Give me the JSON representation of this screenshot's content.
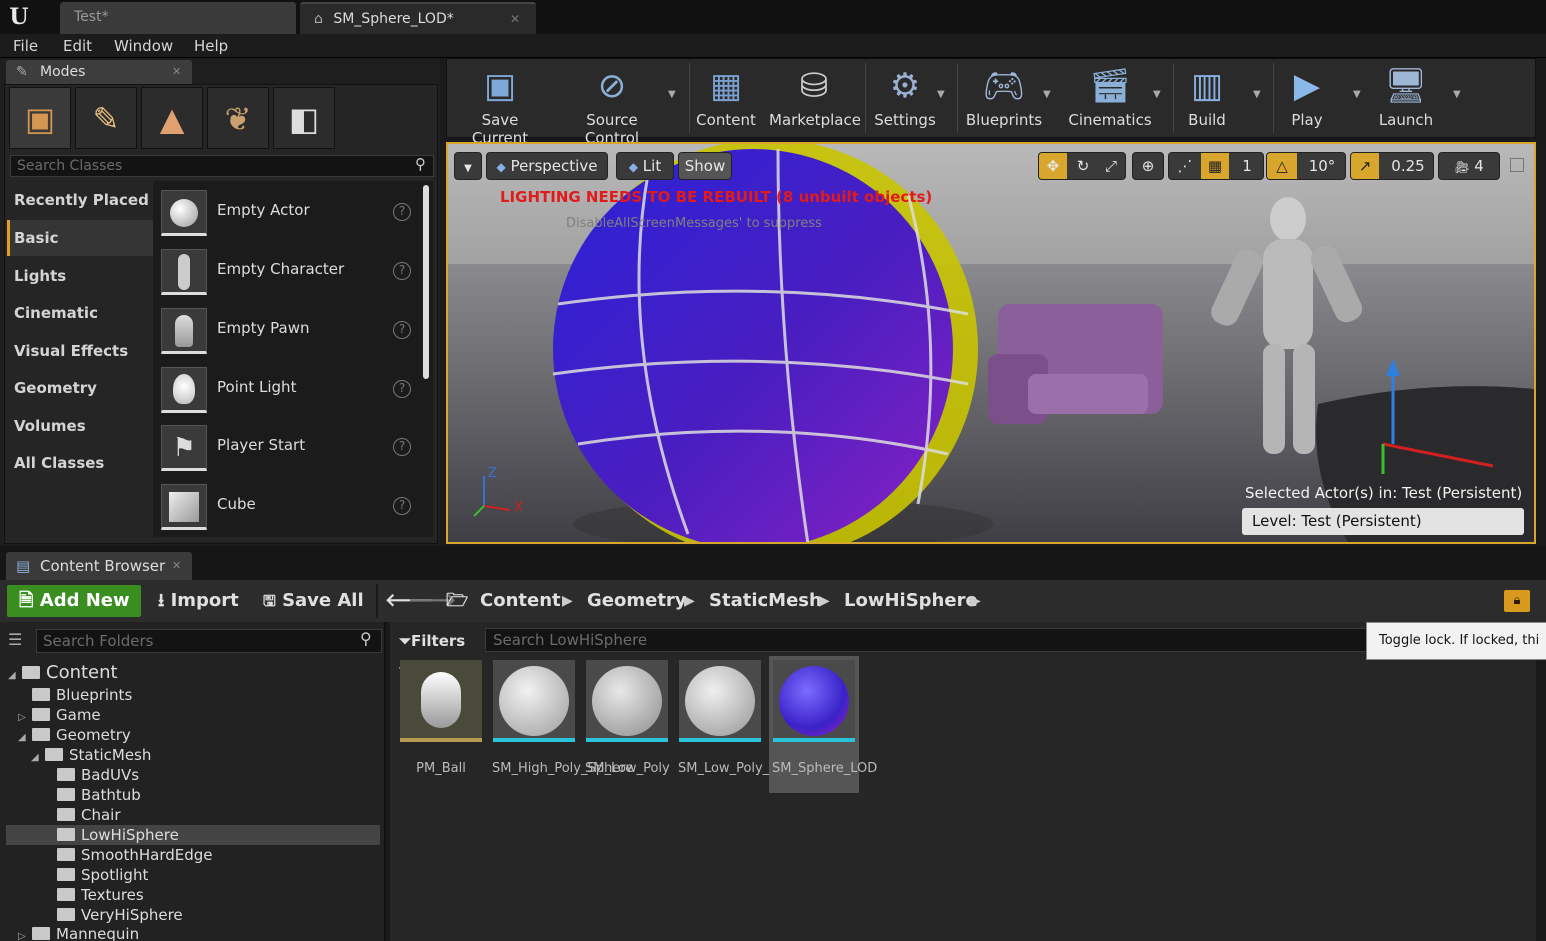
{
  "window": {
    "logo": "U",
    "tabs": [
      {
        "label": "Test*"
      },
      {
        "label": "SM_Sphere_LOD*"
      }
    ]
  },
  "menu": [
    "File",
    "Edit",
    "Window",
    "Help"
  ],
  "modes": {
    "title": "Modes",
    "search_placeholder": "Search Classes",
    "categories": [
      "Recently Placed",
      "Basic",
      "Lights",
      "Cinematic",
      "Visual Effects",
      "Geometry",
      "Volumes",
      "All Classes"
    ],
    "selected_category": "Basic",
    "items": [
      {
        "label": "Empty Actor",
        "icon": "empty-actor-icon"
      },
      {
        "label": "Empty Character",
        "icon": "empty-character-icon"
      },
      {
        "label": "Empty Pawn",
        "icon": "empty-pawn-icon"
      },
      {
        "label": "Point Light",
        "icon": "point-light-icon"
      },
      {
        "label": "Player Start",
        "icon": "player-start-icon"
      },
      {
        "label": "Cube",
        "icon": "cube-icon"
      }
    ]
  },
  "toolbar": {
    "buttons": [
      {
        "label": "Save Current",
        "icon": "save-icon"
      },
      {
        "label": "Source Control",
        "icon": "source-control-icon"
      },
      {
        "label": "Content",
        "icon": "content-icon"
      },
      {
        "label": "Marketplace",
        "icon": "marketplace-icon"
      },
      {
        "label": "Settings",
        "icon": "settings-icon"
      },
      {
        "label": "Blueprints",
        "icon": "blueprints-icon"
      },
      {
        "label": "Cinematics",
        "icon": "cinematics-icon"
      },
      {
        "label": "Build",
        "icon": "build-icon"
      },
      {
        "label": "Play",
        "icon": "play-icon"
      },
      {
        "label": "Launch",
        "icon": "launch-icon"
      }
    ]
  },
  "viewport": {
    "perspective": "Perspective",
    "lit": "Lit",
    "show": "Show",
    "camera_speed": "1",
    "rotation_snap": "10°",
    "scale_snap": "0.25",
    "camera_speed_value": "4",
    "lighting_warning": "LIGHTING NEEDS TO BE REBUILT (8 unbuilt objects)",
    "disable_msg": "DisableAllScreenMessages' to suppress",
    "selected_actor": "Selected Actor(s) in:  Test (Persistent)",
    "level": "Level:  Test (Persistent)",
    "axis_x": "X",
    "axis_z": "Z",
    "accent": "#d9a62d"
  },
  "content_browser": {
    "title": "Content Browser",
    "add_new": "Add New",
    "import": "Import",
    "save_all": "Save All",
    "breadcrumb": [
      "Content",
      "Geometry",
      "StaticMesh",
      "LowHiSphere"
    ],
    "search_folders": "Search Folders",
    "filters": "Filters",
    "search_assets": "Search LowHiSphere",
    "tooltip": "Toggle lock. If locked, thi",
    "tree": [
      {
        "label": "Content",
        "depth": 0,
        "expanded": true
      },
      {
        "label": "Blueprints",
        "depth": 1
      },
      {
        "label": "Game",
        "depth": 1,
        "collapsed": true
      },
      {
        "label": "Geometry",
        "depth": 1,
        "expanded": true
      },
      {
        "label": "StaticMesh",
        "depth": 2,
        "expanded": true
      },
      {
        "label": "BadUVs",
        "depth": 3
      },
      {
        "label": "Bathtub",
        "depth": 3
      },
      {
        "label": "Chair",
        "depth": 3
      },
      {
        "label": "LowHiSphere",
        "depth": 3,
        "selected": true
      },
      {
        "label": "SmoothHardEdge",
        "depth": 3
      },
      {
        "label": "Spotlight",
        "depth": 3
      },
      {
        "label": "Textures",
        "depth": 3
      },
      {
        "label": "VeryHiSphere",
        "depth": 3
      },
      {
        "label": "Mannequin",
        "depth": 1,
        "collapsed": true
      }
    ],
    "assets": [
      {
        "name": "PM_Ball",
        "selected": false
      },
      {
        "name": "SM_High_Poly_Sphere",
        "selected": false
      },
      {
        "name": "SM_Low_Poly",
        "selected": false
      },
      {
        "name": "SM_Low_Poly_Norm",
        "selected": false
      },
      {
        "name": "SM_Sphere_LOD",
        "selected": true
      }
    ],
    "addnew_color": "#3a8d1f"
  }
}
